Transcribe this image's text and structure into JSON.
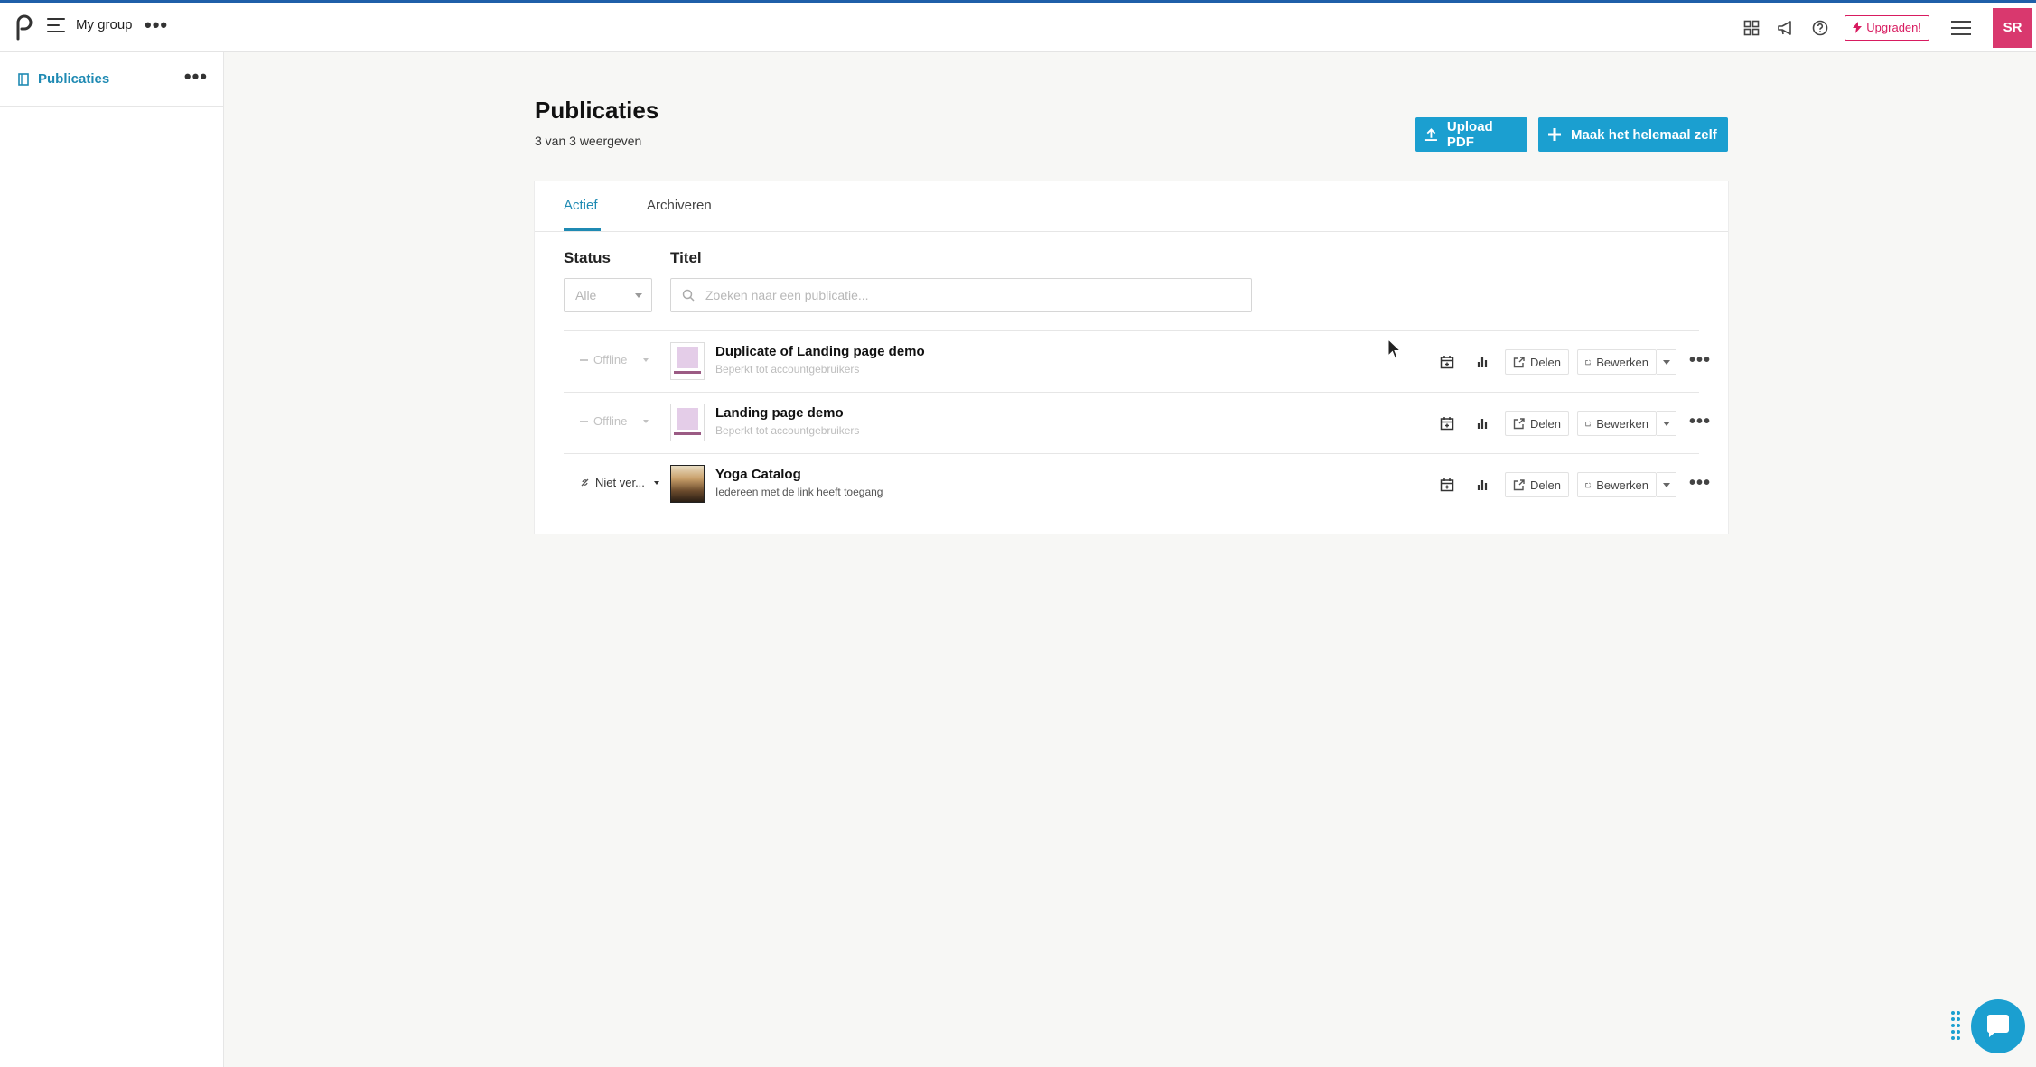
{
  "colors": {
    "accent": "#1f8ab3",
    "primary_button": "#1b9fd0",
    "upgrade": "#d81b60",
    "avatar_bg": "#d9386e",
    "topline": "#1f5fa9"
  },
  "topbar": {
    "group_name": "My group",
    "upgrade_label": "Upgraden!",
    "avatar_initials": "SR",
    "icons": [
      "grid-icon",
      "megaphone-icon",
      "help-icon",
      "bolt-icon",
      "menu-icon"
    ]
  },
  "sidebar": {
    "items": [
      {
        "label": "Publicaties",
        "icon": "publication-icon"
      }
    ]
  },
  "page": {
    "title": "Publicaties",
    "subtitle": "3 van 3 weergeven",
    "upload_label": "Upload PDF",
    "make_label": "Maak het helemaal zelf"
  },
  "tabs": {
    "active": "Actief",
    "archive": "Archiveren"
  },
  "filters": {
    "status_label": "Status",
    "status_value": "Alle",
    "title_label": "Titel",
    "search_placeholder": "Zoeken naar een publicatie..."
  },
  "publications": [
    {
      "state": "Offline",
      "title": "Duplicate of Landing page demo",
      "access": "Beperkt tot accountgebruikers",
      "share": "Delen",
      "edit": "Bewerken"
    },
    {
      "state": "Offline",
      "title": "Landing page demo",
      "access": "Beperkt tot accountgebruikers",
      "share": "Delen",
      "edit": "Bewerken"
    },
    {
      "state": "Niet ver...",
      "title": "Yoga Catalog",
      "access": "Iedereen met de link heeft toegang",
      "share": "Delen",
      "edit": "Bewerken"
    }
  ]
}
